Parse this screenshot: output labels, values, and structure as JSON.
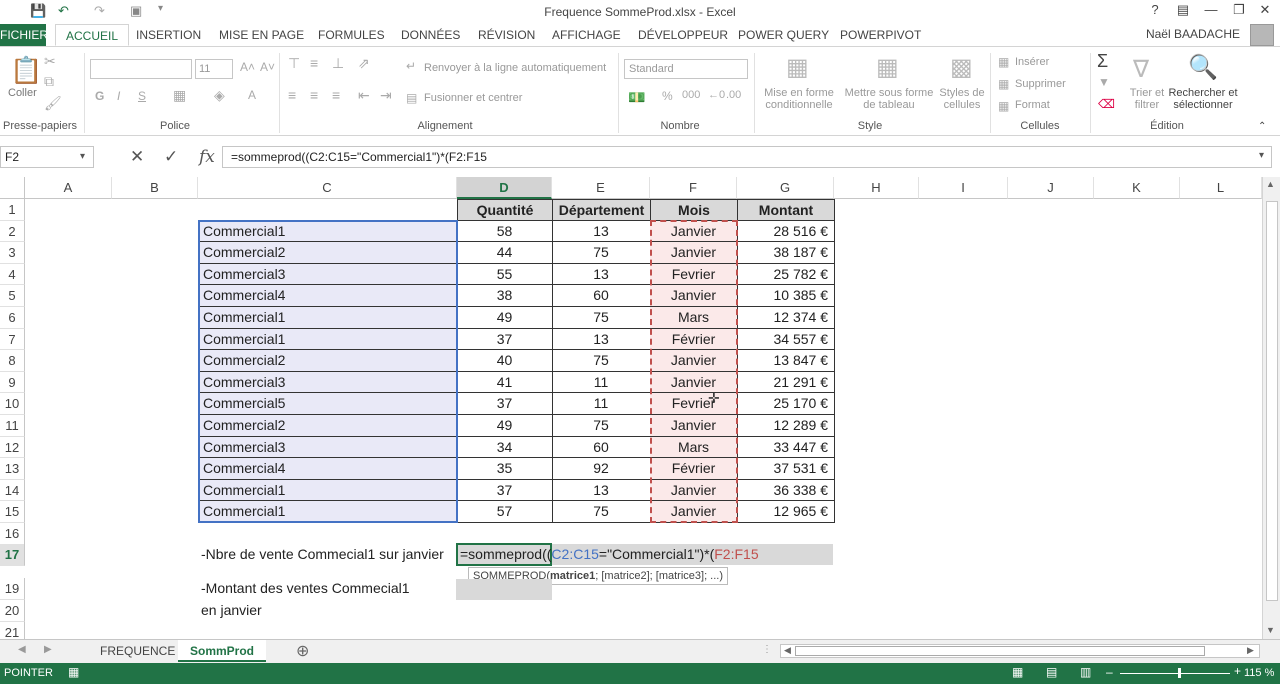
{
  "window": {
    "title": "Frequence SommeProd.xlsx - Excel",
    "help": "?",
    "user": "Naël BAADACHE"
  },
  "tabs": {
    "file": "FICHIER",
    "home": "ACCUEIL",
    "insert": "INSERTION",
    "layout": "MISE EN PAGE",
    "formulas": "FORMULES",
    "data": "DONNÉES",
    "review": "RÉVISION",
    "view": "AFFICHAGE",
    "developer": "DÉVELOPPEUR",
    "powerquery": "POWER QUERY",
    "powerpivot": "POWERPIVOT"
  },
  "ribbon": {
    "clipboard": {
      "paste": "Coller",
      "label": "Presse-papiers"
    },
    "font": {
      "size": "11",
      "label": "Police"
    },
    "alignment": {
      "wrap": "Renvoyer à la ligne automatiquement",
      "merge": "Fusionner et centrer",
      "label": "Alignement"
    },
    "number": {
      "format": "Standard",
      "label": "Nombre"
    },
    "styles": {
      "conditional_1": "Mise en forme",
      "conditional_2": "conditionnelle",
      "table_1": "Mettre sous forme",
      "table_2": "de tableau",
      "cell_1": "Styles de",
      "cell_2": "cellules",
      "label": "Style"
    },
    "cells": {
      "insert": "Insérer",
      "delete": "Supprimer",
      "format": "Format",
      "label": "Cellules"
    },
    "edit": {
      "sort_1": "Trier et",
      "sort_2": "filtrer",
      "find_1": "Rechercher et",
      "find_2": "sélectionner",
      "label": "Édition"
    }
  },
  "formula_bar": {
    "name_box": "F2",
    "formula": "=sommeprod((C2:C15=\"Commercial1\")*(F2:F15"
  },
  "columns": [
    "A",
    "B",
    "C",
    "D",
    "E",
    "F",
    "G",
    "H",
    "I",
    "J",
    "K",
    "L"
  ],
  "rows": [
    "1",
    "2",
    "3",
    "4",
    "5",
    "6",
    "7",
    "8",
    "9",
    "10",
    "11",
    "12",
    "13",
    "14",
    "15",
    "16",
    "17",
    "19",
    "20",
    "21"
  ],
  "table": {
    "headers": [
      "Quantité",
      "Département",
      "Mois",
      "Montant"
    ],
    "rows": [
      [
        "Commercial1",
        "58",
        "13",
        "Janvier",
        "28 516 €"
      ],
      [
        "Commercial2",
        "44",
        "75",
        "Janvier",
        "38 187 €"
      ],
      [
        "Commercial3",
        "55",
        "13",
        "Fevrier",
        "25 782 €"
      ],
      [
        "Commercial4",
        "38",
        "60",
        "Janvier",
        "10 385 €"
      ],
      [
        "Commercial1",
        "49",
        "75",
        "Mars",
        "12 374 €"
      ],
      [
        "Commercial1",
        "37",
        "13",
        "Février",
        "34 557 €"
      ],
      [
        "Commercial2",
        "40",
        "75",
        "Janvier",
        "13 847 €"
      ],
      [
        "Commercial3",
        "41",
        "11",
        "Janvier",
        "21 291 €"
      ],
      [
        "Commercial5",
        "37",
        "11",
        "Fevrier",
        "25 170 €"
      ],
      [
        "Commercial2",
        "49",
        "75",
        "Janvier",
        "12 289 €"
      ],
      [
        "Commercial3",
        "34",
        "60",
        "Mars",
        "33 447 €"
      ],
      [
        "Commercial4",
        "35",
        "92",
        "Février",
        "37 531 €"
      ],
      [
        "Commercial1",
        "37",
        "13",
        "Janvier",
        "36 338 €"
      ],
      [
        "Commercial1",
        "57",
        "75",
        "Janvier",
        "12 965 €"
      ]
    ]
  },
  "notes": {
    "r17": "-Nbre de vente Commecial1 sur janvier",
    "r19": "-Montant des ventes Commecial1",
    "r20": "en janvier",
    "edit_p1": "=sommeprod((",
    "edit_p2": "C2:C15",
    "edit_p3": "=\"Commercial1\")*(",
    "edit_p4": "F2:F15",
    "tooltip_fn": "SOMMEPROD(",
    "tooltip_arg": "matrice1",
    "tooltip_rest": "; [matrice2]; [matrice3]; ...)"
  },
  "sheets": {
    "tab1": "FREQUENCE",
    "tab2": "SommProd"
  },
  "status": {
    "mode": "POINTER",
    "zoom": "115 %"
  },
  "colors": {
    "excel_green": "#217346",
    "range_blue": "#4472c4",
    "range_red": "#c0504d"
  }
}
